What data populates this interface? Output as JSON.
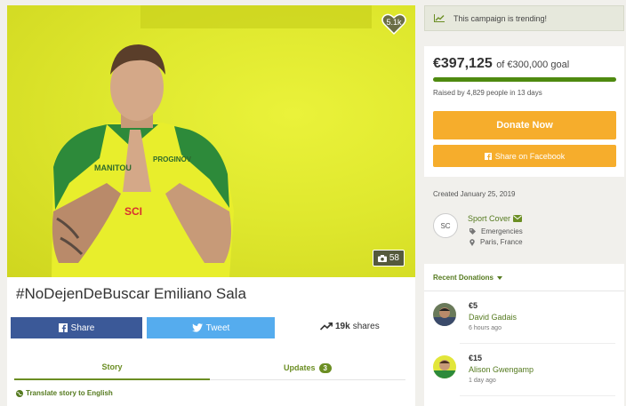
{
  "hero": {
    "likes_count": "5.1k",
    "photo_count": "58"
  },
  "campaign": {
    "title": "#NoDejenDeBuscar Emiliano Sala"
  },
  "share_bar": {
    "share_label": "Share",
    "tweet_label": "Tweet",
    "shares_count": "19k",
    "shares_label": "shares"
  },
  "tabs": [
    {
      "label": "Story"
    },
    {
      "label": "Updates",
      "badge": "3"
    }
  ],
  "translate_label": "Translate story to English",
  "trending_text": "This campaign is trending!",
  "funding": {
    "raised_amount": "€397,125",
    "goal_text": "of €300,000 goal",
    "raised_by": "Raised by 4,829 people in 13 days",
    "progress_percent": 100,
    "donate_label": "Donate Now",
    "facebook_label": "Share on Facebook"
  },
  "created_text": "Created January 25, 2019",
  "organizer": {
    "initials": "SC",
    "name": "Sport Cover",
    "category": "Emergencies",
    "location": "Paris, France"
  },
  "donations": {
    "heading": "Recent Donations",
    "items": [
      {
        "amount": "€5",
        "name": "David Gadais",
        "time": "6 hours ago"
      },
      {
        "amount": "€15",
        "name": "Alison Gwengamp",
        "time": "1 day ago"
      }
    ]
  },
  "colors": {
    "accent_green": "#6b8e23",
    "donate_orange": "#f6ad2c",
    "facebook_blue": "#3b5998",
    "twitter_blue": "#55acee"
  }
}
